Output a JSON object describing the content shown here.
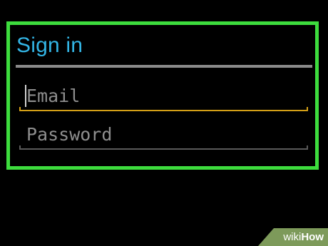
{
  "dialog": {
    "title": "Sign in",
    "email": {
      "placeholder": "Email",
      "focused": true
    },
    "password": {
      "placeholder": "Password",
      "focused": false
    }
  },
  "watermark": {
    "prefix": "wiki",
    "suffix": "How"
  },
  "colors": {
    "background": "#000000",
    "highlight_frame": "#3ddc3d",
    "title": "#33b5e5",
    "focused_underline": "#d4a017",
    "placeholder_text": "#8e8e8e"
  }
}
